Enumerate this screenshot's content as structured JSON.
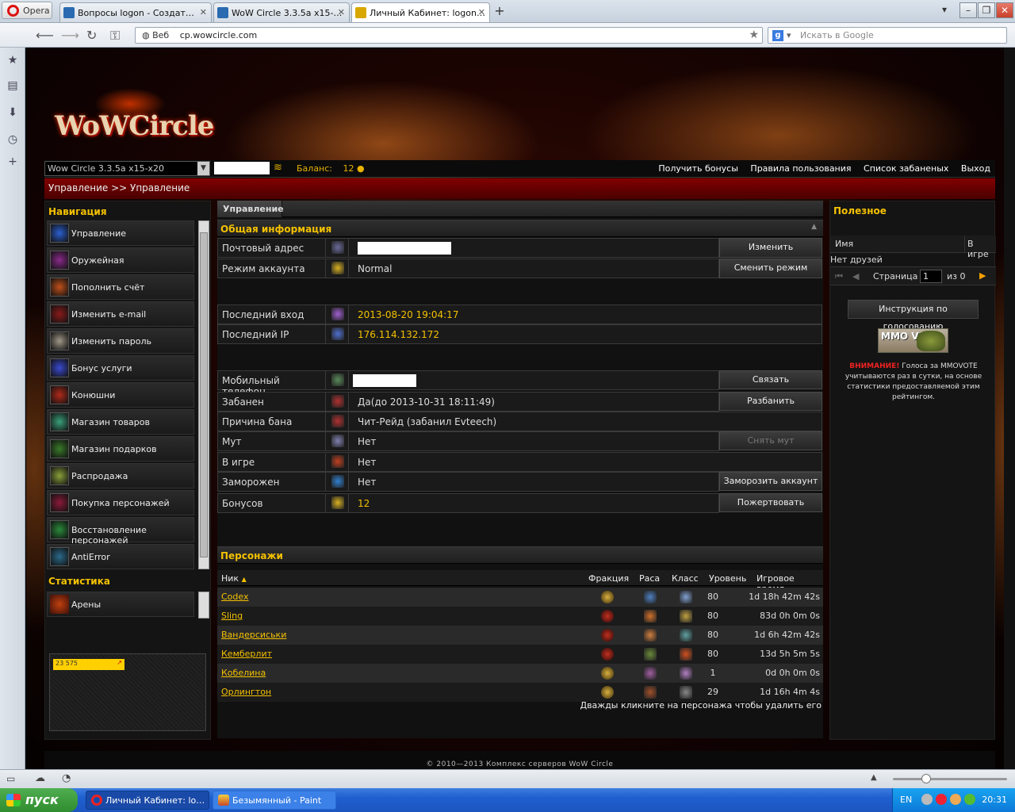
{
  "browser": {
    "opera_label": "Opera",
    "tabs": [
      {
        "label": "Вопросы logon - Создат…",
        "active": false
      },
      {
        "label": "WoW Circle 3.3.5a x15-…",
        "active": false
      },
      {
        "label": "Личный Кабинет: logon…",
        "active": true
      }
    ],
    "address": {
      "prefix": "Веб",
      "url": "cp.wowcircle.com"
    },
    "search_placeholder": "Искать в Google",
    "colors": {
      "accent": "#f4c100",
      "brand_red": "#820000"
    }
  },
  "site": {
    "logo_text": "WoWCircle",
    "realm": "Wow Circle 3.3.5a x15-x20",
    "balance_label": "Баланс:",
    "balance_value": "12",
    "top_links": [
      "Получить бонусы",
      "Правила пользования",
      "Список забаненых",
      "Выход"
    ],
    "breadcrumb": "Управление >> Управление",
    "nav": {
      "title": "Навигация",
      "items": [
        {
          "label": "Управление",
          "icon": "management-icon",
          "color": "#2a5fd0"
        },
        {
          "label": "Оружейная",
          "icon": "armory-icon",
          "color": "#8a2a8a"
        },
        {
          "label": "Пополнить счёт",
          "icon": "deposit-icon",
          "color": "#c0501a"
        },
        {
          "label": "Изменить e-mail",
          "icon": "email-icon",
          "color": "#8a1a1a"
        },
        {
          "label": "Изменить пароль",
          "icon": "password-icon",
          "color": "#a09888"
        },
        {
          "label": "Бонус услуги",
          "icon": "bonus-icon",
          "color": "#3a4ad0"
        },
        {
          "label": "Конюшни",
          "icon": "stables-icon",
          "color": "#b02a1a"
        },
        {
          "label": "Магазин товаров",
          "icon": "shop-icon",
          "color": "#3aa07a"
        },
        {
          "label": "Магазин подарков",
          "icon": "gift-shop-icon",
          "color": "#3a7a2a"
        },
        {
          "label": "Распродажа",
          "icon": "sale-icon",
          "color": "#8aa03a"
        },
        {
          "label": "Покупка персонажей",
          "icon": "buy-character-icon",
          "color": "#8a1a3a"
        },
        {
          "label": "Восстановление персонажей",
          "icon": "restore-character-icon",
          "color": "#2a8a3a"
        },
        {
          "label": "AntiError",
          "icon": "antierror-icon",
          "color": "#2a6a8a"
        }
      ]
    },
    "stats": {
      "title": "Статистика",
      "items": [
        {
          "label": "Арены",
          "icon": "arena-icon"
        }
      ],
      "counter_text": "23 575"
    },
    "main": {
      "tab_label": "Управление",
      "general_title": "Общая информация",
      "rows": [
        {
          "label": "Почтовый адрес",
          "value": "",
          "icon": "mail-icon",
          "button": "Изменить"
        },
        {
          "label": "Режим аккаунта",
          "value": "Normal",
          "icon": "star-icon",
          "button": "Сменить режим"
        },
        {
          "label": "Последний вход",
          "value": "2013-08-20 19:04:17",
          "icon": "last-login-icon"
        },
        {
          "label": "Последний IP",
          "value": "176.114.132.172",
          "icon": "ip-icon"
        },
        {
          "label": "Мобильный телефон",
          "value": "",
          "icon": "phone-icon",
          "button": "Связать"
        },
        {
          "label": "Забанен",
          "value": "Да(до 2013-10-31 18:11:49)",
          "icon": "banned-icon",
          "button": "Разбанить"
        },
        {
          "label": "Причина бана",
          "value": "Чит-Рейд (забанил Evteech)",
          "icon": "ban-reason-icon"
        },
        {
          "label": "Мут",
          "value": "Нет",
          "icon": "mute-icon",
          "button": "Снять мут"
        },
        {
          "label": "В игре",
          "value": "Нет",
          "icon": "in-game-icon"
        },
        {
          "label": "Заморожен",
          "value": "Нет",
          "icon": "frozen-icon",
          "button": "Заморозить аккаунт"
        },
        {
          "label": "Бонусов",
          "value": "12",
          "icon": "bonus-coin-icon",
          "button": "Пожертвовать"
        }
      ],
      "characters_title": "Персонажи",
      "char_columns": [
        "Ник",
        "Фракция",
        "Раса",
        "Класс",
        "Уровень",
        "Игровое время"
      ],
      "characters": [
        {
          "nick": "Codex",
          "faction": "alliance",
          "level": "80",
          "time": "1d 18h 42m 42s"
        },
        {
          "nick": "Sling",
          "faction": "horde",
          "level": "80",
          "time": "83d 0h 0m 0s"
        },
        {
          "nick": "Вандерсиськи",
          "faction": "horde",
          "level": "80",
          "time": "1d 6h 42m 42s"
        },
        {
          "nick": "Кемберлит",
          "faction": "horde",
          "level": "80",
          "time": "13d 5h 5m 5s"
        },
        {
          "nick": "Кобелина",
          "faction": "alliance",
          "level": "1",
          "time": "0d 0h 0m 0s"
        },
        {
          "nick": "Орлингтон",
          "faction": "alliance",
          "level": "29",
          "time": "1d 16h 4m 4s"
        }
      ],
      "char_hint": "Дважды кликните на персонажа чтобы удалить его"
    },
    "useful": {
      "title": "Полезное",
      "name_col": "Имя",
      "ingame_col": "В игре",
      "no_friends": "Нет друзей",
      "page_label": "Страница",
      "page_value": "1",
      "page_of": "из 0",
      "vote_button": "Инструкция по голосованию",
      "mmo_text": "MMO VOTE",
      "warn_label": "ВНИМАНИЕ!",
      "warn_text": "Голоса за MMOVOTE учитываются раз в сутки, на основе статистики предоставляемой этим рейтингом."
    },
    "footer": "© 2010—2013 Комплекс серверов WoW Circle"
  },
  "taskbar": {
    "start": "пуск",
    "tasks": [
      "Личный Кабинет: lo…",
      "Безымянный - Paint"
    ],
    "lang": "EN",
    "clock": "20:31"
  }
}
